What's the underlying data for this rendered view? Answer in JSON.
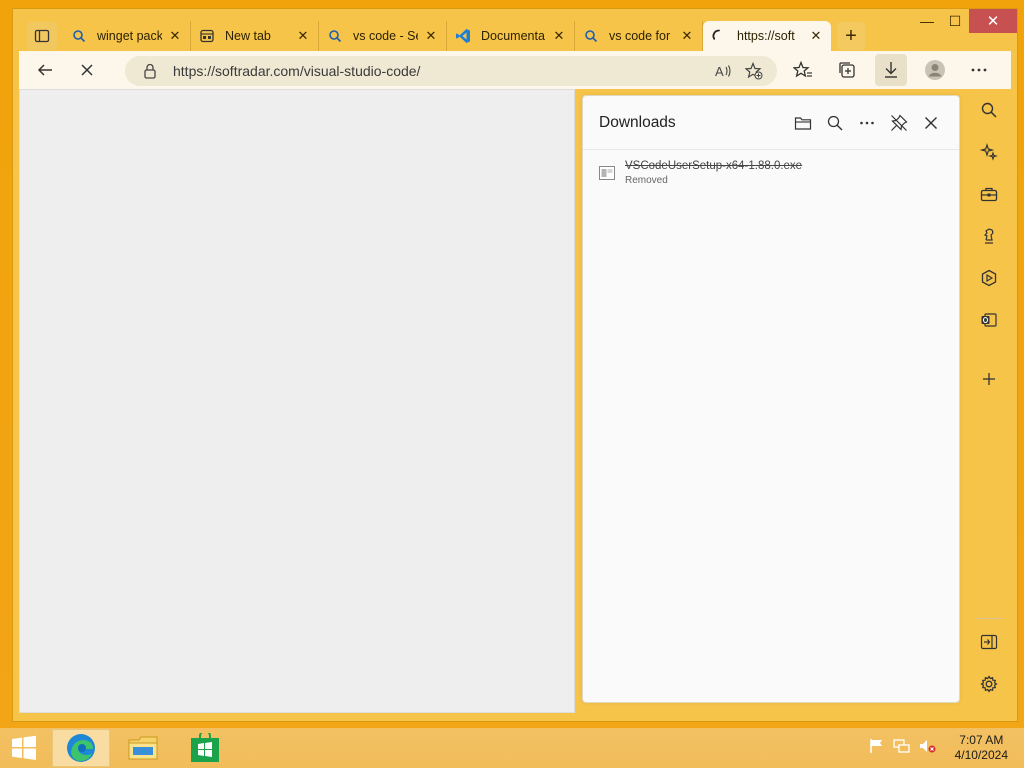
{
  "window": {
    "caption": {
      "minimize": "—",
      "maximize": "☐",
      "close": "✕"
    }
  },
  "tabs": [
    {
      "title": "winget pack",
      "icon": "search-icon",
      "close": "✕"
    },
    {
      "title": "New tab",
      "icon": "newtab-icon",
      "close": "✕"
    },
    {
      "title": "vs code - Se",
      "icon": "search-icon",
      "close": "✕"
    },
    {
      "title": "Documenta",
      "icon": "vscode-icon",
      "close": "✕"
    },
    {
      "title": "vs code for",
      "icon": "search-icon",
      "close": "✕"
    },
    {
      "title": "https://soft",
      "icon": "loading-icon",
      "close": "✕",
      "active": true
    }
  ],
  "new_tab_label": "+",
  "address_bar": {
    "url": "https://softradar.com/visual-studio-code/"
  },
  "downloads": {
    "title": "Downloads",
    "items": [
      {
        "filename": "VSCodeUserSetup-x64-1.88.0.exe",
        "status": "Removed"
      }
    ]
  },
  "clock": {
    "time": "7:07 AM",
    "date": "4/10/2024"
  },
  "colors": {
    "desktop": "#f0a30a",
    "chrome": "#f7c44a",
    "toolbar": "#fcf7ea"
  }
}
